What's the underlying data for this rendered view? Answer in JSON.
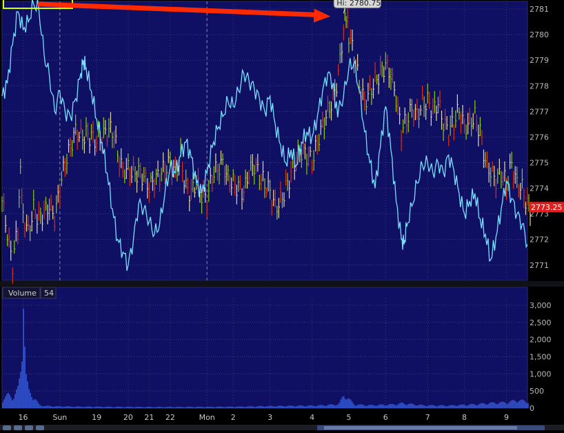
{
  "colors": {
    "background": "#000000",
    "plot_bg": "#0f0f64",
    "grid": "#3a3a78",
    "axis_text": "#b9b9b9",
    "price_up": "#8ed000",
    "price_down": "#e03010",
    "price_neutral": "#e8d8a8",
    "indicator_line": "#79e1ff",
    "volume_bar": "#3050c8",
    "arrow": "#ff2a00",
    "highlight_box": "#d4ff00",
    "last_price_bg": "#e02020",
    "panel_divider": "#1a1a1a"
  },
  "chart_data": [
    {
      "type": "line",
      "panel": "price",
      "ylim": [
        2770.4,
        2781.3
      ],
      "y_ticks": [
        2771,
        2772,
        2773,
        2774,
        2775,
        2776,
        2777,
        2778,
        2779,
        2780,
        2781
      ],
      "x_ticks": [
        {
          "label": "16",
          "x": 0.04
        },
        {
          "label": "Sun",
          "x": 0.11
        },
        {
          "label": "19",
          "x": 0.18
        },
        {
          "label": "20",
          "x": 0.24
        },
        {
          "label": "21",
          "x": 0.28
        },
        {
          "label": "22",
          "x": 0.32
        },
        {
          "label": "Mon",
          "x": 0.39
        },
        {
          "label": "2",
          "x": 0.44
        },
        {
          "label": "3",
          "x": 0.51
        },
        {
          "label": "4",
          "x": 0.59
        },
        {
          "label": "5",
          "x": 0.66
        },
        {
          "label": "6",
          "x": 0.73
        },
        {
          "label": "7",
          "x": 0.81
        },
        {
          "label": "8",
          "x": 0.88
        },
        {
          "label": "9",
          "x": 0.96
        }
      ],
      "session_breaks": [
        0.11,
        0.39
      ],
      "hi_label": "Hi: 2780.75",
      "hi_value": 2780.75,
      "hi_x": 0.65,
      "last_price_label": "2773.25",
      "last_price": 2773.25,
      "series": [
        {
          "kind": "price_bars",
          "points": [
            [
              0.0,
              2773.5
            ],
            [
              0.01,
              2772.2
            ],
            [
              0.02,
              2771.0
            ],
            [
              0.03,
              2772.5
            ],
            [
              0.035,
              2775.0
            ],
            [
              0.04,
              2773.0
            ],
            [
              0.05,
              2772.3
            ],
            [
              0.06,
              2773.2
            ],
            [
              0.07,
              2772.8
            ],
            [
              0.08,
              2773.0
            ],
            [
              0.09,
              2773.3
            ],
            [
              0.1,
              2772.8
            ],
            [
              0.11,
              2774.0
            ],
            [
              0.12,
              2775.0
            ],
            [
              0.13,
              2775.6
            ],
            [
              0.14,
              2776.3
            ],
            [
              0.15,
              2776.0
            ],
            [
              0.16,
              2776.1
            ],
            [
              0.17,
              2776.0
            ],
            [
              0.18,
              2775.8
            ],
            [
              0.19,
              2776.0
            ],
            [
              0.2,
              2776.2
            ],
            [
              0.21,
              2776.3
            ],
            [
              0.22,
              2775.4
            ],
            [
              0.23,
              2774.7
            ],
            [
              0.24,
              2774.8
            ],
            [
              0.25,
              2774.6
            ],
            [
              0.26,
              2774.6
            ],
            [
              0.27,
              2774.4
            ],
            [
              0.28,
              2774.0
            ],
            [
              0.29,
              2774.3
            ],
            [
              0.3,
              2774.5
            ],
            [
              0.31,
              2774.8
            ],
            [
              0.32,
              2775.0
            ],
            [
              0.33,
              2774.6
            ],
            [
              0.34,
              2775.2
            ],
            [
              0.35,
              2774.0
            ],
            [
              0.36,
              2773.8
            ],
            [
              0.37,
              2774.2
            ],
            [
              0.38,
              2773.7
            ],
            [
              0.39,
              2773.5
            ],
            [
              0.4,
              2774.5
            ],
            [
              0.41,
              2774.8
            ],
            [
              0.42,
              2775.0
            ],
            [
              0.43,
              2774.4
            ],
            [
              0.44,
              2774.2
            ],
            [
              0.45,
              2774.0
            ],
            [
              0.46,
              2773.8
            ],
            [
              0.47,
              2774.6
            ],
            [
              0.48,
              2774.9
            ],
            [
              0.49,
              2774.5
            ],
            [
              0.5,
              2774.2
            ],
            [
              0.51,
              2773.9
            ],
            [
              0.52,
              2773.3
            ],
            [
              0.53,
              2773.5
            ],
            [
              0.54,
              2774.0
            ],
            [
              0.55,
              2774.5
            ],
            [
              0.56,
              2775.1
            ],
            [
              0.57,
              2775.4
            ],
            [
              0.58,
              2775.3
            ],
            [
              0.59,
              2775.0
            ],
            [
              0.6,
              2775.8
            ],
            [
              0.61,
              2776.5
            ],
            [
              0.62,
              2777.0
            ],
            [
              0.63,
              2777.5
            ],
            [
              0.64,
              2778.4
            ],
            [
              0.65,
              2780.2
            ],
            [
              0.655,
              2780.75
            ],
            [
              0.66,
              2780.0
            ],
            [
              0.67,
              2779.2
            ],
            [
              0.68,
              2778.1
            ],
            [
              0.69,
              2777.4
            ],
            [
              0.7,
              2777.8
            ],
            [
              0.71,
              2778.2
            ],
            [
              0.72,
              2778.5
            ],
            [
              0.73,
              2778.8
            ],
            [
              0.74,
              2778.4
            ],
            [
              0.75,
              2777.5
            ],
            [
              0.76,
              2776.2
            ],
            [
              0.77,
              2776.7
            ],
            [
              0.78,
              2777.1
            ],
            [
              0.79,
              2776.9
            ],
            [
              0.8,
              2777.3
            ],
            [
              0.81,
              2777.4
            ],
            [
              0.82,
              2777.0
            ],
            [
              0.83,
              2777.3
            ],
            [
              0.84,
              2776.5
            ],
            [
              0.85,
              2776.2
            ],
            [
              0.86,
              2776.6
            ],
            [
              0.87,
              2777.1
            ],
            [
              0.88,
              2776.4
            ],
            [
              0.89,
              2776.6
            ],
            [
              0.9,
              2776.8
            ],
            [
              0.91,
              2776.2
            ],
            [
              0.92,
              2775.0
            ],
            [
              0.93,
              2774.6
            ],
            [
              0.94,
              2774.3
            ],
            [
              0.95,
              2774.6
            ],
            [
              0.96,
              2774.2
            ],
            [
              0.97,
              2775.0
            ],
            [
              0.98,
              2774.2
            ],
            [
              0.99,
              2774.0
            ],
            [
              1.0,
              2773.3
            ]
          ]
        },
        {
          "kind": "indicator",
          "points": [
            [
              0.0,
              2777.6
            ],
            [
              0.01,
              2778.1
            ],
            [
              0.02,
              2779.6
            ],
            [
              0.03,
              2780.9
            ],
            [
              0.04,
              2780.2
            ],
            [
              0.05,
              2780.5
            ],
            [
              0.06,
              2781.2
            ],
            [
              0.07,
              2781.0
            ],
            [
              0.08,
              2779.2
            ],
            [
              0.09,
              2778.4
            ],
            [
              0.1,
              2777.0
            ],
            [
              0.11,
              2777.8
            ],
            [
              0.12,
              2777.0
            ],
            [
              0.13,
              2776.8
            ],
            [
              0.14,
              2777.5
            ],
            [
              0.15,
              2778.5
            ],
            [
              0.155,
              2779.0
            ],
            [
              0.16,
              2778.7
            ],
            [
              0.17,
              2777.8
            ],
            [
              0.18,
              2776.7
            ],
            [
              0.19,
              2775.8
            ],
            [
              0.2,
              2774.6
            ],
            [
              0.21,
              2773.2
            ],
            [
              0.22,
              2772.0
            ],
            [
              0.23,
              2771.5
            ],
            [
              0.24,
              2771.0
            ],
            [
              0.25,
              2772.0
            ],
            [
              0.26,
              2773.4
            ],
            [
              0.27,
              2773.2
            ],
            [
              0.28,
              2772.7
            ],
            [
              0.29,
              2772.2
            ],
            [
              0.3,
              2772.6
            ],
            [
              0.31,
              2773.8
            ],
            [
              0.32,
              2774.8
            ],
            [
              0.33,
              2774.6
            ],
            [
              0.34,
              2775.3
            ],
            [
              0.35,
              2775.8
            ],
            [
              0.36,
              2775.2
            ],
            [
              0.37,
              2774.2
            ],
            [
              0.38,
              2773.8
            ],
            [
              0.39,
              2774.6
            ],
            [
              0.4,
              2775.6
            ],
            [
              0.41,
              2776.3
            ],
            [
              0.42,
              2776.8
            ],
            [
              0.43,
              2777.4
            ],
            [
              0.44,
              2777.2
            ],
            [
              0.45,
              2777.8
            ],
            [
              0.46,
              2778.5
            ],
            [
              0.47,
              2778.2
            ],
            [
              0.48,
              2777.9
            ],
            [
              0.49,
              2777.5
            ],
            [
              0.5,
              2777.0
            ],
            [
              0.51,
              2777.6
            ],
            [
              0.52,
              2776.5
            ],
            [
              0.53,
              2775.7
            ],
            [
              0.54,
              2775.0
            ],
            [
              0.55,
              2775.5
            ],
            [
              0.56,
              2774.9
            ],
            [
              0.57,
              2775.8
            ],
            [
              0.58,
              2776.2
            ],
            [
              0.59,
              2776.0
            ],
            [
              0.6,
              2776.8
            ],
            [
              0.61,
              2777.8
            ],
            [
              0.62,
              2778.5
            ],
            [
              0.63,
              2778.1
            ],
            [
              0.635,
              2777.2
            ],
            [
              0.64,
              2777.0
            ],
            [
              0.65,
              2777.6
            ],
            [
              0.66,
              2778.7
            ],
            [
              0.67,
              2778.9
            ],
            [
              0.68,
              2777.8
            ],
            [
              0.69,
              2776.2
            ],
            [
              0.7,
              2775.0
            ],
            [
              0.71,
              2774.0
            ],
            [
              0.72,
              2775.6
            ],
            [
              0.73,
              2777.2
            ],
            [
              0.74,
              2775.5
            ],
            [
              0.75,
              2773.5
            ],
            [
              0.76,
              2772.0
            ],
            [
              0.765,
              2771.8
            ],
            [
              0.77,
              2772.5
            ],
            [
              0.78,
              2773.3
            ],
            [
              0.79,
              2774.2
            ],
            [
              0.8,
              2774.9
            ],
            [
              0.81,
              2775.0
            ],
            [
              0.82,
              2774.6
            ],
            [
              0.83,
              2775.0
            ],
            [
              0.84,
              2774.6
            ],
            [
              0.85,
              2775.3
            ],
            [
              0.86,
              2774.7
            ],
            [
              0.87,
              2773.8
            ],
            [
              0.88,
              2773.0
            ],
            [
              0.89,
              2773.5
            ],
            [
              0.9,
              2773.8
            ],
            [
              0.91,
              2772.8
            ],
            [
              0.92,
              2772.2
            ],
            [
              0.93,
              2771.2
            ],
            [
              0.94,
              2772.1
            ],
            [
              0.95,
              2773.2
            ],
            [
              0.96,
              2774.3
            ],
            [
              0.97,
              2773.6
            ],
            [
              0.98,
              2773.0
            ],
            [
              0.99,
              2772.6
            ],
            [
              1.0,
              2771.8
            ]
          ]
        }
      ]
    },
    {
      "type": "bar",
      "panel": "volume",
      "title": "Volume",
      "last_value": "54",
      "ylim": [
        0,
        3200
      ],
      "y_ticks": [
        {
          "value": 0,
          "label": "0"
        },
        {
          "value": 500,
          "label": "500"
        },
        {
          "value": 1000,
          "label": "1,000"
        },
        {
          "value": 1500,
          "label": "1,500"
        },
        {
          "value": 2000,
          "label": "2,000"
        },
        {
          "value": 2500,
          "label": "2,500"
        },
        {
          "value": 3000,
          "label": "3,000"
        }
      ],
      "series": [
        {
          "values": [
            [
              0.0,
              280
            ],
            [
              0.01,
              410
            ],
            [
              0.02,
              330
            ],
            [
              0.03,
              620
            ],
            [
              0.035,
              1250
            ],
            [
              0.04,
              2900
            ],
            [
              0.045,
              900
            ],
            [
              0.05,
              520
            ],
            [
              0.055,
              420
            ],
            [
              0.06,
              330
            ],
            [
              0.07,
              90
            ],
            [
              0.08,
              70
            ],
            [
              0.1,
              55
            ],
            [
              0.15,
              45
            ],
            [
              0.2,
              40
            ],
            [
              0.25,
              38
            ],
            [
              0.3,
              35
            ],
            [
              0.35,
              38
            ],
            [
              0.4,
              40
            ],
            [
              0.45,
              45
            ],
            [
              0.5,
              60
            ],
            [
              0.55,
              70
            ],
            [
              0.6,
              80
            ],
            [
              0.64,
              120
            ],
            [
              0.65,
              420
            ],
            [
              0.66,
              260
            ],
            [
              0.67,
              110
            ],
            [
              0.7,
              90
            ],
            [
              0.75,
              120
            ],
            [
              0.76,
              150
            ],
            [
              0.8,
              90
            ],
            [
              0.85,
              80
            ],
            [
              0.9,
              120
            ],
            [
              0.93,
              160
            ],
            [
              0.96,
              180
            ],
            [
              0.98,
              250
            ],
            [
              1.0,
              200
            ]
          ]
        }
      ]
    }
  ]
}
